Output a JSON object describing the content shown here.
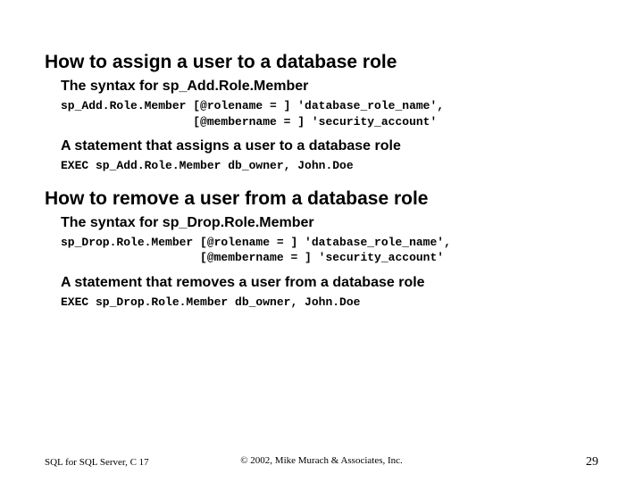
{
  "section1": {
    "heading": "How to assign a user to a database role",
    "sub1": "The syntax for sp_Add.Role.Member",
    "code1": "sp_Add.Role.Member [@rolename = ] 'database_role_name',\n                   [@membername = ] 'security_account'",
    "sub2": "A statement that assigns a user to a database role",
    "code2": "EXEC sp_Add.Role.Member db_owner, John.Doe"
  },
  "section2": {
    "heading": "How to remove a user from a database role",
    "sub1": "The syntax for sp_Drop.Role.Member",
    "code1": "sp_Drop.Role.Member [@rolename = ] 'database_role_name',\n                    [@membername = ] 'security_account'",
    "sub2": "A statement that removes a user from a database role",
    "code2": "EXEC sp_Drop.Role.Member db_owner, John.Doe"
  },
  "footer": {
    "left": "SQL for SQL Server, C 17",
    "center": "© 2002, Mike Murach & Associates, Inc.",
    "page": "29"
  }
}
